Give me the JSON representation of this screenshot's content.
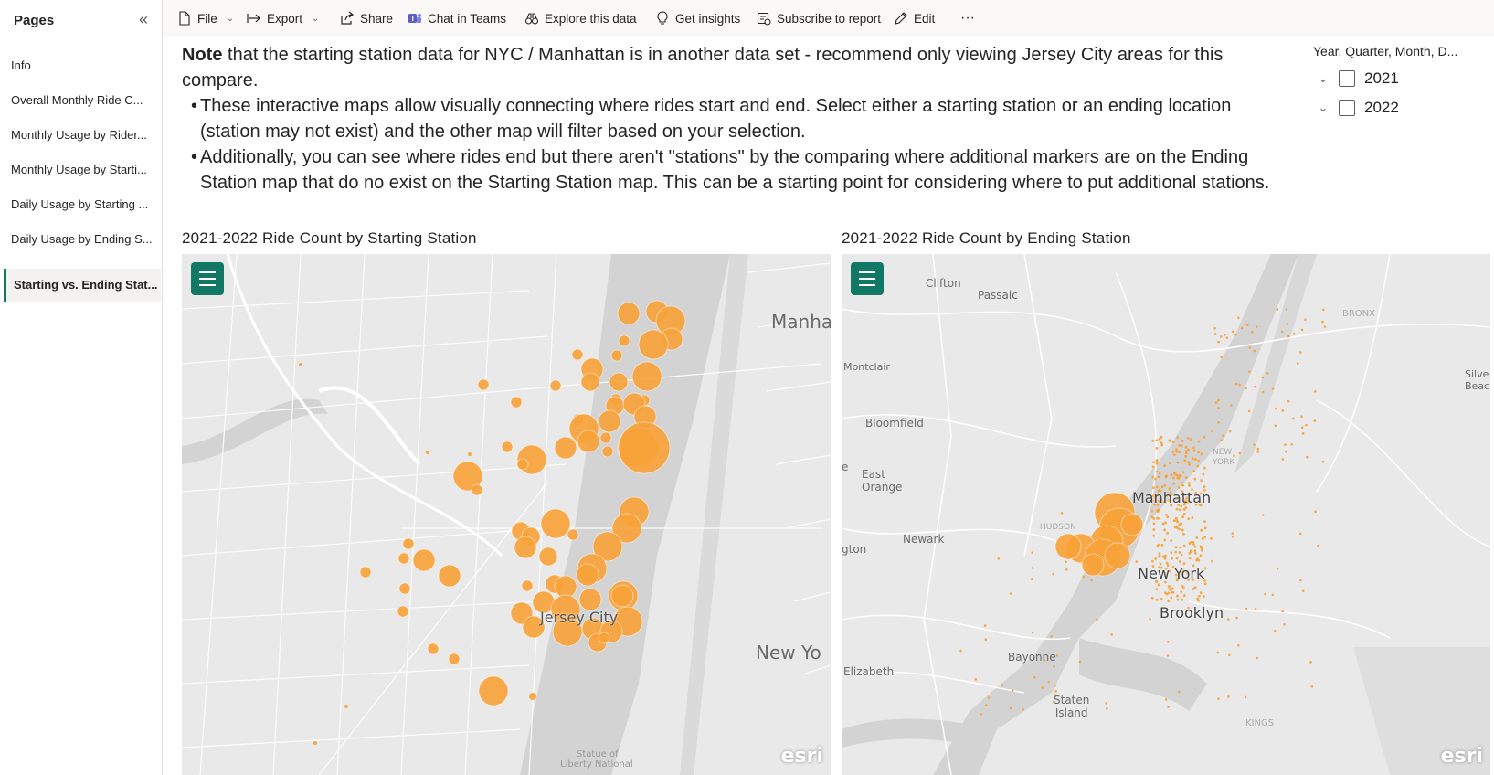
{
  "pages": {
    "header": "Pages",
    "collapse_icon": "«",
    "items": [
      {
        "label": "Info"
      },
      {
        "label": "Overall Monthly Ride C..."
      },
      {
        "label": "Monthly Usage by Rider..."
      },
      {
        "label": "Monthly Usage by Starti..."
      },
      {
        "label": "Daily Usage by Starting ..."
      },
      {
        "label": "Daily Usage by Ending S..."
      },
      {
        "label": "Starting vs. Ending Stat..."
      }
    ]
  },
  "toolbar": {
    "file": "File",
    "export": "Export",
    "share": "Share",
    "chat": "Chat in Teams",
    "explore": "Explore this data",
    "insights": "Get insights",
    "subscribe": "Subscribe to report",
    "edit": "Edit",
    "more": "···"
  },
  "note": {
    "bold": "Note",
    "line1": " that the starting station data for NYC / Manhattan is in another data set - recommend only viewing Jersey City areas for this compare.",
    "bullet1": "These interactive maps allow visually connecting where rides start and end. Select either a starting station or an ending location (station may not exist) and the other map will filter based on your selection.",
    "bullet2": "Additionally, you can see where rides end but there aren't \"stations\" by the comparing where additional markers are on the Ending Station map that do no exist on the Starting Station map. This can be a starting point for considering where to put additional stations."
  },
  "slicer": {
    "title": "Year, Quarter, Month, D...",
    "options": [
      {
        "label": "2021",
        "checked": false
      },
      {
        "label": "2022",
        "checked": false
      }
    ]
  },
  "maps": {
    "start_title": "2021-2022 Ride Count by Starting Station",
    "end_title": "2021-2022 Ride Count by Ending Station",
    "marker_color": "#f7a23a",
    "accent_color": "#117865",
    "start_labels": {
      "manhattan": "Manha",
      "jersey_city": "Jersey City",
      "new_york": "New Yo",
      "statue": "Statue of",
      "liberty": "Liberty National"
    },
    "end_labels": {
      "clifton": "Clifton",
      "passaic": "Passaic",
      "montclair": "Montclair",
      "bloomfield": "Bloomfield",
      "east_orange": "East\nOrange",
      "newark": "Newark",
      "irvington": "gton",
      "hudson": "HUDSON",
      "manhattan": "Manhattan",
      "new_york": "New York",
      "brooklyn": "Brooklyn",
      "bayonne": "Bayonne",
      "elizabeth": "Elizabeth",
      "staten_island": "Staten\nIsland",
      "kings": "KINGS",
      "bronx": "BRONX",
      "new_york_small": "NEW\nYORK",
      "silver_beach": "Silve\nBeach",
      "e": "e"
    },
    "attribution": "esri"
  }
}
